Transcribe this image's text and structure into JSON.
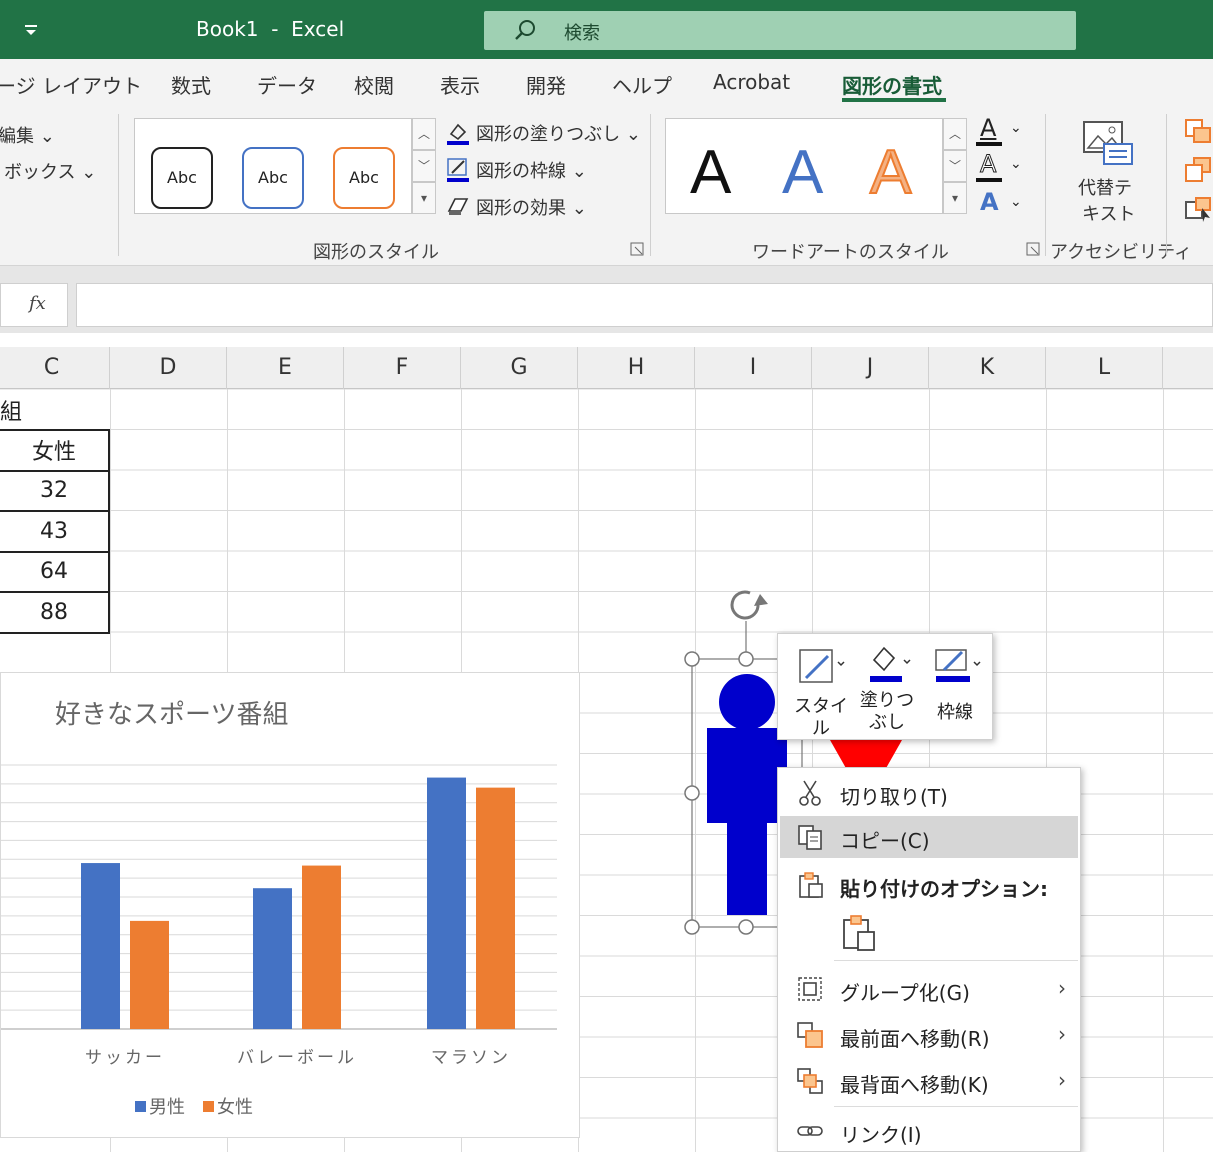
{
  "titlebar": {
    "title": "Book1  -  Excel",
    "search_placeholder": "検索"
  },
  "tabs": [
    {
      "label": "ージ レイアウト"
    },
    {
      "label": "数式"
    },
    {
      "label": "データ"
    },
    {
      "label": "校閲"
    },
    {
      "label": "表示"
    },
    {
      "label": "開発"
    },
    {
      "label": "ヘルプ"
    },
    {
      "label": "Acrobat"
    },
    {
      "label": "図形の書式"
    }
  ],
  "ribbon": {
    "left_items": [
      "編集",
      "ボックス"
    ],
    "style_gallery": [
      "Abc",
      "Abc",
      "Abc"
    ],
    "shape_commands": [
      "図形の塗りつぶし",
      "図形の枠線",
      "図形の効果"
    ],
    "shape_styles_label": "図形のスタイル",
    "wordart_letters": [
      "A",
      "A",
      "A"
    ],
    "wordart_small": [
      "A",
      "A",
      "A"
    ],
    "wordart_label": "ワードアートのスタイル",
    "alt_text_label": [
      "代替テ",
      "キスト"
    ],
    "accessibility_label": "アクセシビリティ"
  },
  "formula_bar": {
    "fx": "fx",
    "value": ""
  },
  "grid": {
    "columns": [
      "C",
      "D",
      "E",
      "F",
      "G",
      "H",
      "I",
      "J",
      "K",
      "L"
    ],
    "cell_c1": "組",
    "table": [
      "女性",
      "32",
      "43",
      "64",
      "88"
    ]
  },
  "chart_data": {
    "type": "bar",
    "title": "好きなスポーツ番組",
    "categories": [
      "サッカー",
      "バレーボール",
      "マラソン"
    ],
    "series": [
      {
        "name": "男性",
        "values": [
          66,
          56,
          100
        ],
        "color": "#4472c4"
      },
      {
        "name": "女性",
        "values": [
          43,
          65,
          96
        ],
        "color": "#ed7d31"
      }
    ],
    "ylim": [
      0,
      105
    ],
    "grid": true,
    "legend": "bottom"
  },
  "mini_toolbar": {
    "style": "スタイル",
    "fill": [
      "塗りつ",
      "ぶし"
    ],
    "outline": "枠線"
  },
  "context_menu": {
    "cut": "切り取り(T)",
    "copy": "コピー(C)",
    "paste_options": "貼り付けのオプション:",
    "group": "グループ化(G)",
    "bring_front": "最前面へ移動(R)",
    "send_back": "最背面へ移動(K)",
    "link": "リンク(I)",
    "arrow": "›"
  },
  "colors": {
    "excel_green": "#217346",
    "person_blue": "#0000cc",
    "person_red": "#ff0000"
  }
}
